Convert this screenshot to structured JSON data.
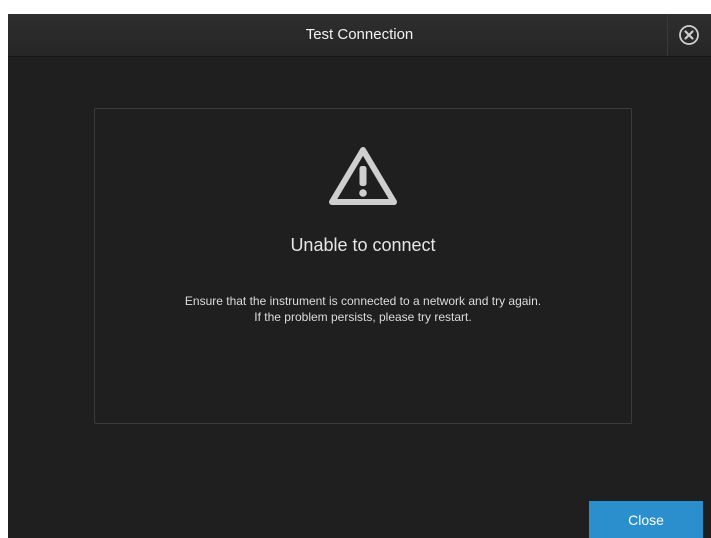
{
  "dialog": {
    "title": "Test Connection",
    "close_icon": "close-circle-x-icon"
  },
  "message": {
    "icon": "warning-triangle-icon",
    "title": "Unable to connect",
    "line1": "Ensure that the instrument is connected to a network and try again.",
    "line2": "If the problem persists, please try restart."
  },
  "footer": {
    "close_label": "Close"
  },
  "colors": {
    "background": "#1f1f1f",
    "header": "#2a2a2a",
    "accent_button": "#2b8fce",
    "icon": "#cfcfcf"
  }
}
